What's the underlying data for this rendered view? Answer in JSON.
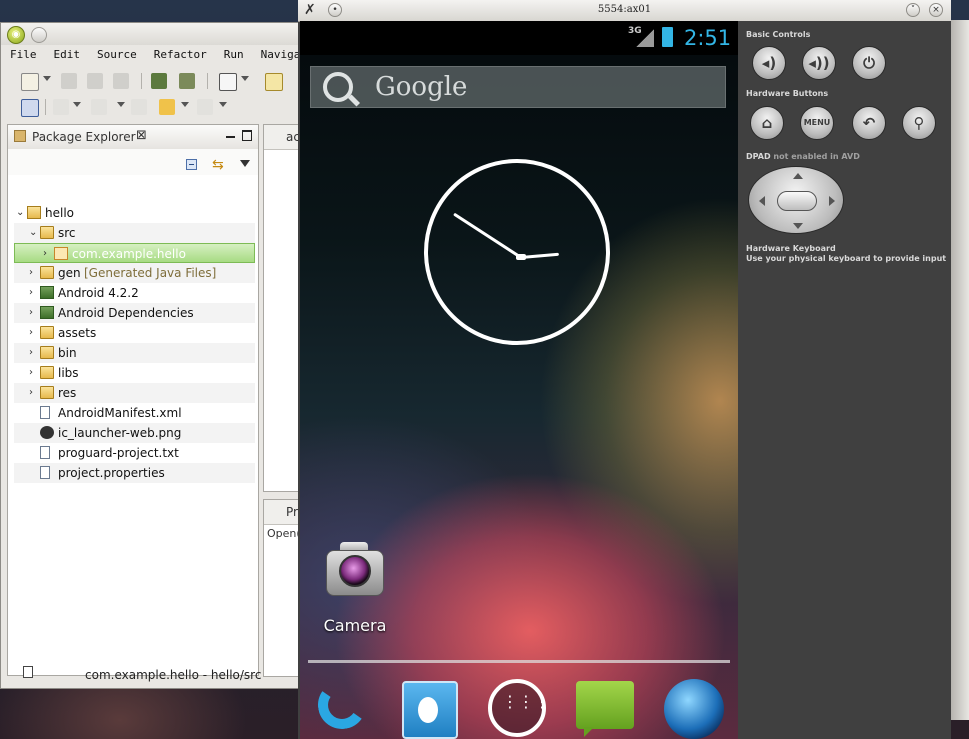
{
  "eclipse": {
    "menu": [
      "File",
      "Edit",
      "Source",
      "Refactor",
      "Run",
      "Navigate"
    ],
    "package_explorer": {
      "title": "Package Explorer",
      "close_glyph": "⊠",
      "tree": [
        {
          "label": "hello",
          "decoration": "",
          "icon": "project-folder-icon",
          "depth": 0,
          "expanded": true
        },
        {
          "label": "src",
          "decoration": "",
          "icon": "source-folder-icon",
          "depth": 1,
          "expanded": true
        },
        {
          "label": "com.example.hello",
          "decoration": "",
          "icon": "package-icon",
          "depth": 2,
          "expanded": false,
          "selected": true
        },
        {
          "label": "gen",
          "decoration": "[Generated Java Files]",
          "icon": "source-folder-icon",
          "depth": 1,
          "expanded": false
        },
        {
          "label": "Android 4.2.2",
          "decoration": "",
          "icon": "library-icon",
          "depth": 1,
          "expanded": false
        },
        {
          "label": "Android Dependencies",
          "decoration": "",
          "icon": "library-icon",
          "depth": 1,
          "expanded": false
        },
        {
          "label": "assets",
          "decoration": "",
          "icon": "folder-icon",
          "depth": 1,
          "expanded": false
        },
        {
          "label": "bin",
          "decoration": "",
          "icon": "folder-icon",
          "depth": 1,
          "expanded": false
        },
        {
          "label": "libs",
          "decoration": "",
          "icon": "folder-icon",
          "depth": 1,
          "expanded": false
        },
        {
          "label": "res",
          "decoration": "",
          "icon": "folder-icon",
          "depth": 1,
          "expanded": false
        },
        {
          "label": "AndroidManifest.xml",
          "decoration": "",
          "icon": "xml-file-icon",
          "depth": 1,
          "expanded": null
        },
        {
          "label": "ic_launcher-web.png",
          "decoration": "",
          "icon": "image-file-icon",
          "depth": 1,
          "expanded": null
        },
        {
          "label": "proguard-project.txt",
          "decoration": "",
          "icon": "text-file-icon",
          "depth": 1,
          "expanded": null
        },
        {
          "label": "project.properties",
          "decoration": "",
          "icon": "text-file-icon",
          "depth": 1,
          "expanded": null
        }
      ]
    },
    "editor_tab": "ac",
    "problems_tab": "Pr",
    "problems_text": "Open(",
    "status": "com.example.hello - hello/src"
  },
  "emulator": {
    "window_title": "5554:ax01",
    "status_bar": {
      "network": "3G",
      "time": "2:51",
      "accent": "#33b5e5"
    },
    "search_label": "Google",
    "clock": {
      "hour": 2,
      "minute": 51
    },
    "home_app": "Camera",
    "dock": [
      "phone-icon",
      "contacts-icon",
      "all-apps-icon",
      "messaging-icon",
      "browser-icon"
    ],
    "apps_glyph": "⋮⋮⋮",
    "controls": {
      "basic_heading": "Basic Controls",
      "basic_buttons": [
        "volume-down-icon",
        "volume-up-icon",
        "power-icon"
      ],
      "hardware_heading": "Hardware Buttons",
      "menu_label": "MENU",
      "dpad_note_strong": "DPAD",
      "dpad_note_rest": "not enabled in AVD",
      "keyboard_heading": "Hardware Keyboard",
      "keyboard_note": "Use your physical keyboard to provide input"
    }
  }
}
